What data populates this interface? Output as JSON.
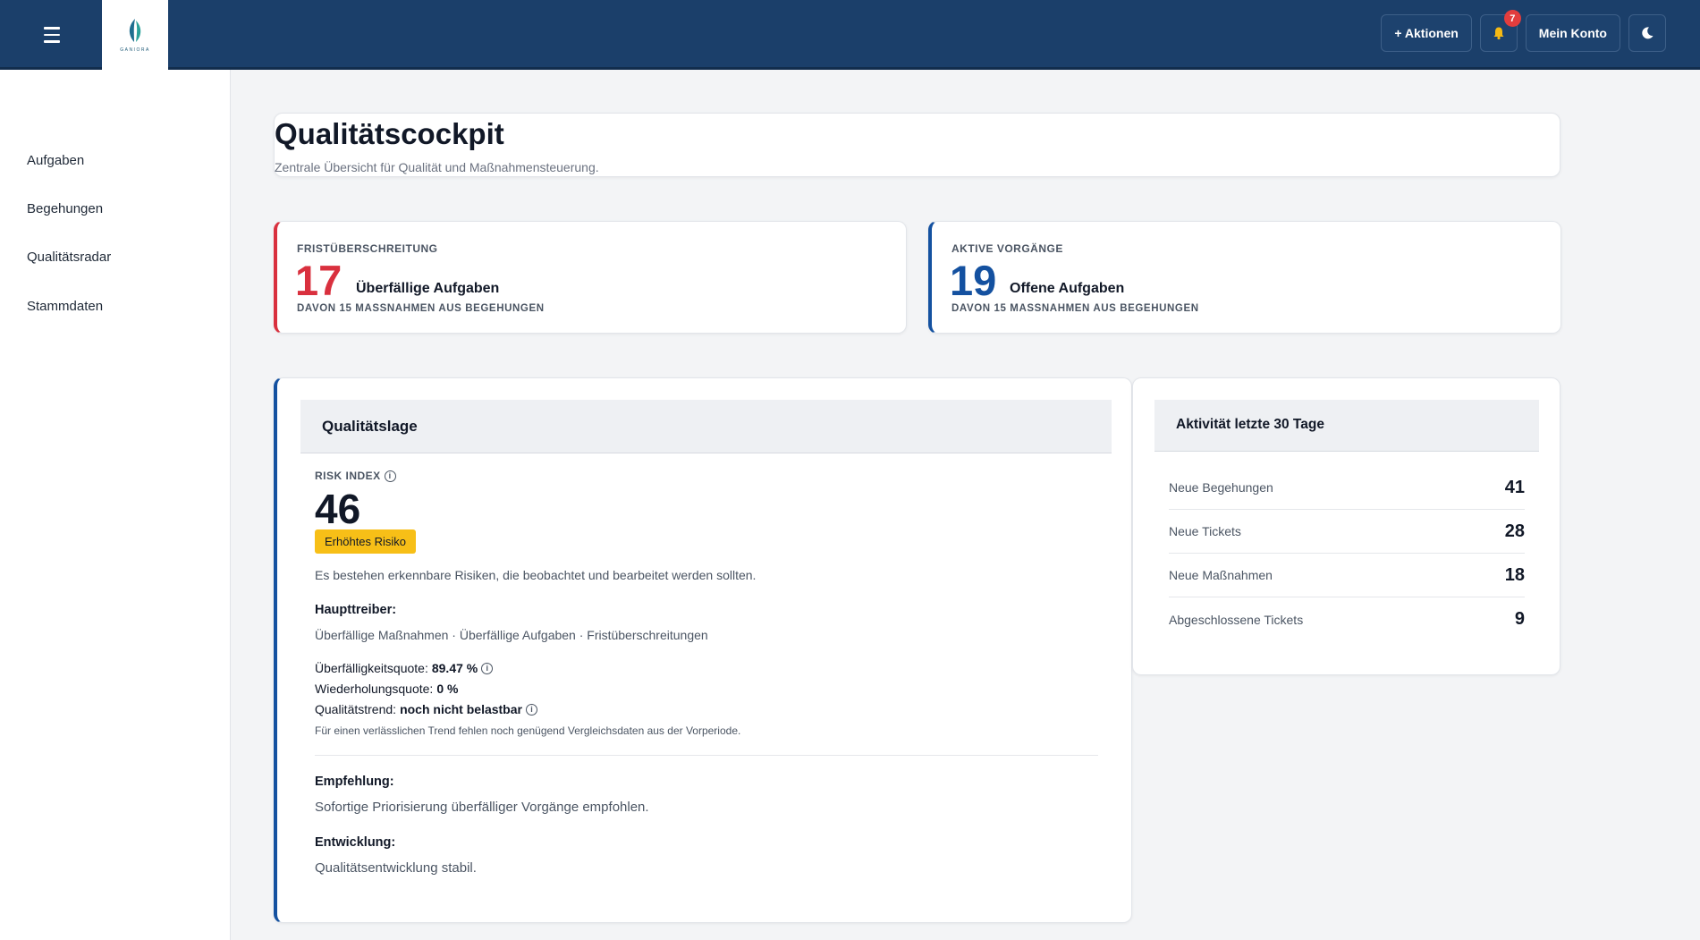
{
  "topbar": {
    "logo_text": "GANIORA",
    "actions_label": "+ Aktionen",
    "notifications_count": "7",
    "account_label": "Mein Konto",
    "accent_color": "#1b3f6a"
  },
  "sidebar": {
    "items": [
      {
        "label": "Aufgaben"
      },
      {
        "label": "Begehungen"
      },
      {
        "label": "Qualitätsradar"
      },
      {
        "label": "Stammdaten"
      }
    ]
  },
  "header": {
    "title": "Qualitätscockpit",
    "subtitle": "Zentrale Übersicht für Qualität und Maßnahmensteuerung."
  },
  "stats": [
    {
      "label": "FRISTÜBERSCHREITUNG",
      "value": "17",
      "description": "Überfällige Aufgaben",
      "footnote": "DAVON 15 MASSNAHMEN AUS BEGEHUNGEN",
      "color": "#d9303e"
    },
    {
      "label": "AKTIVE VORGÄNGE",
      "value": "19",
      "description": "Offene Aufgaben",
      "footnote": "DAVON 15 MASSNAHMEN AUS BEGEHUNGEN",
      "color": "#1451a0"
    }
  ],
  "quality": {
    "title": "Qualitätslage",
    "risk_label": "RISK INDEX",
    "risk_value": "46",
    "risk_badge": "Erhöhtes Risiko",
    "risk_badge_color": "#f7bf17",
    "risk_text": "Es bestehen erkennbare Risiken, die beobachtet und bearbeitet werden sollten.",
    "drivers_label": "Haupttreiber:",
    "drivers_text": "Überfällige Maßnahmen · Überfällige Aufgaben · Fristüberschreitungen",
    "overdue_label": "Überfälligkeitsquote:",
    "overdue_value": "89.47 %",
    "repeat_label": "Wiederholungsquote:",
    "repeat_value": "0 %",
    "trend_label": "Qualitätstrend:",
    "trend_value": "noch nicht belastbar",
    "trend_note": "Für einen verlässlichen Trend fehlen noch genügend Vergleichsdaten aus der Vorperiode.",
    "recommendation_label": "Empfehlung:",
    "recommendation_text": "Sofortige Priorisierung überfälliger Vorgänge empfohlen.",
    "development_label": "Entwicklung:",
    "development_text": "Qualitätsentwicklung stabil."
  },
  "activity": {
    "title": "Aktivität letzte 30 Tage",
    "rows": [
      {
        "label": "Neue Begehungen",
        "value": "41"
      },
      {
        "label": "Neue Tickets",
        "value": "28"
      },
      {
        "label": "Neue Maßnahmen",
        "value": "18"
      },
      {
        "label": "Abgeschlossene Tickets",
        "value": "9"
      }
    ]
  }
}
